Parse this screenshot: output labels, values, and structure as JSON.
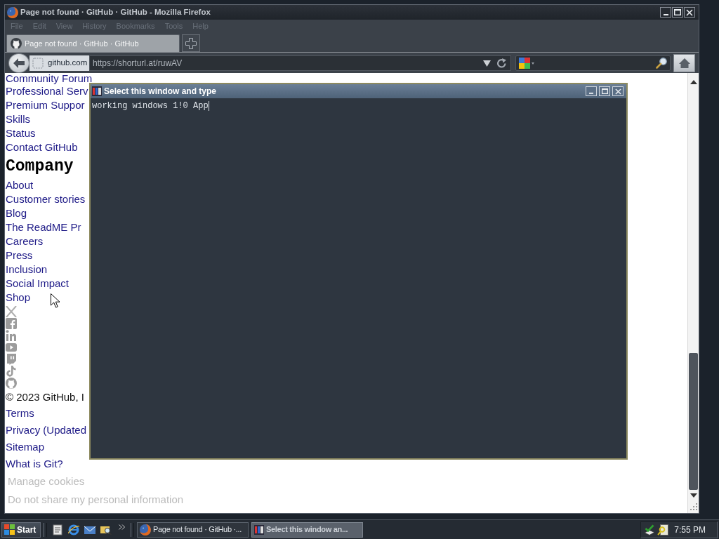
{
  "browser": {
    "title": "Page not found · GitHub · GitHub - Mozilla Firefox",
    "menu": [
      "File",
      "Edit",
      "View",
      "History",
      "Bookmarks",
      "Tools",
      "Help"
    ],
    "tabs": [
      {
        "label": "Page not found · GitHub · GitHub",
        "selected": true
      }
    ],
    "address_bar": {
      "site": "github.com",
      "url": "https://shorturl.at/ruwAV"
    },
    "page": {
      "support_links": [
        "Community Forum",
        "Professional Serv",
        "Premium Suppor",
        "Skills",
        "Status",
        "Contact GitHub"
      ],
      "company_heading": "Company",
      "company_links": [
        "About",
        "Customer stories",
        "Blog",
        "The ReadME Pr",
        "Careers",
        "Press",
        "Inclusion",
        "Social Impact",
        "Shop"
      ],
      "copyright": "© 2023 GitHub, I",
      "legal_links": [
        "Terms",
        "Privacy (Updated",
        "Sitemap",
        "What is Git?"
      ],
      "cookie_buttons": [
        "Manage cookies",
        "Do not share my personal information"
      ]
    }
  },
  "console_window": {
    "title": "Select this window and type",
    "text": "working windows 1!0 App"
  },
  "taskbar": {
    "start": "Start",
    "tasks": [
      {
        "label": "Page not found · GitHub ·...",
        "selected": false
      },
      {
        "label": "Select this window an...",
        "selected": true
      }
    ],
    "clock": "7:55 PM"
  }
}
